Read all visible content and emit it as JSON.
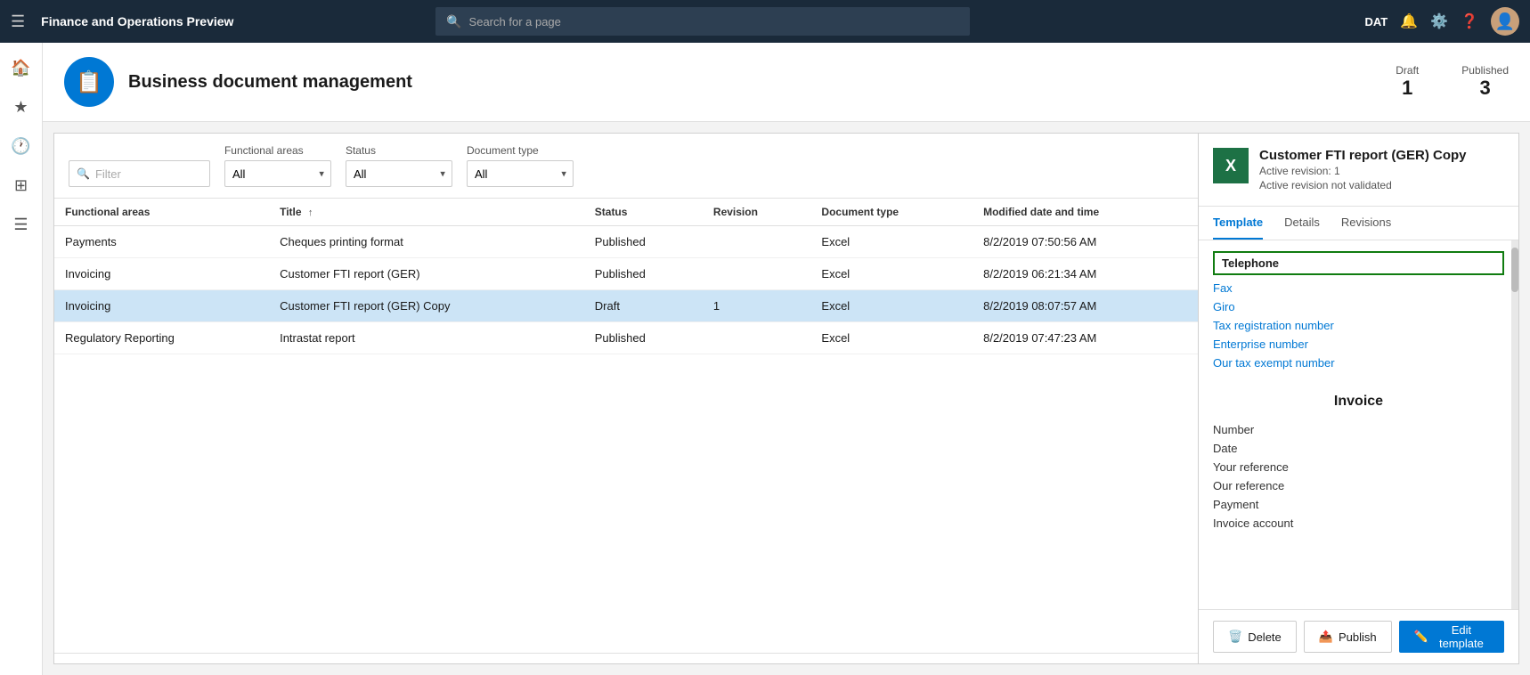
{
  "app": {
    "title": "Finance and Operations Preview",
    "env": "DAT"
  },
  "search": {
    "placeholder": "Search for a page"
  },
  "page": {
    "title": "Business document management",
    "icon": "📋",
    "stats": {
      "draft_label": "Draft",
      "draft_value": "1",
      "published_label": "Published",
      "published_value": "3"
    }
  },
  "filters": {
    "filter_placeholder": "Filter",
    "functional_areas_label": "Functional areas",
    "functional_areas_value": "All",
    "status_label": "Status",
    "status_value": "All",
    "document_type_label": "Document type",
    "document_type_value": "All"
  },
  "table": {
    "columns": [
      "Functional areas",
      "Title",
      "Status",
      "Revision",
      "Document type",
      "Modified date and time"
    ],
    "rows": [
      {
        "functional_area": "Payments",
        "title": "Cheques printing format",
        "status": "Published",
        "revision": "",
        "document_type": "Excel",
        "modified": "8/2/2019 07:50:56 AM",
        "selected": false
      },
      {
        "functional_area": "Invoicing",
        "title": "Customer FTI report (GER)",
        "status": "Published",
        "revision": "",
        "document_type": "Excel",
        "modified": "8/2/2019 06:21:34 AM",
        "selected": false
      },
      {
        "functional_area": "Invoicing",
        "title": "Customer FTI report (GER) Copy",
        "status": "Draft",
        "revision": "1",
        "document_type": "Excel",
        "modified": "8/2/2019 08:07:57 AM",
        "selected": true
      },
      {
        "functional_area": "Regulatory Reporting",
        "title": "Intrastat report",
        "status": "Published",
        "revision": "",
        "document_type": "Excel",
        "modified": "8/2/2019 07:47:23 AM",
        "selected": false
      }
    ]
  },
  "template_panel": {
    "name": "Customer FTI report (GER) Copy",
    "sub1": "Active revision: 1",
    "sub2": "Active revision not validated",
    "tabs": [
      "Template",
      "Details",
      "Revisions"
    ],
    "active_tab": "Template",
    "highlighted_item": "Telephone",
    "links": [
      "Fax",
      "Giro",
      "Tax registration number",
      "Enterprise number",
      "Our tax exempt number"
    ],
    "section_title": "Invoice",
    "fields": [
      "Number",
      "Date",
      "Your reference",
      "Our reference",
      "Payment",
      "Invoice account"
    ]
  },
  "buttons": {
    "delete": "Delete",
    "publish": "Publish",
    "edit_template": "Edit template"
  }
}
